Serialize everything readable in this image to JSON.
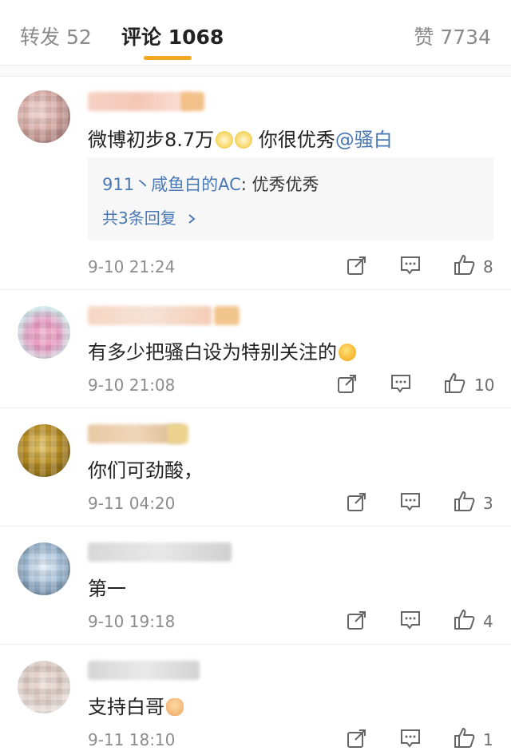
{
  "tabs": {
    "repost": "转发 52",
    "comments": "评论 1068",
    "likes": "赞 7734"
  },
  "comments": [
    {
      "text": "微博初步8.7万",
      "text_suffix": " 你很优秀",
      "mention": "@骚白",
      "reply_user": "911丶咸鱼白的AC",
      "reply_sep": ": ",
      "reply_text": "优秀优秀",
      "reply_more": "共3条回复",
      "time": "9-10 21:24",
      "likes": "8"
    },
    {
      "text": "有多少把骚白设为特别关注的",
      "time": "9-10 21:08",
      "likes": "10"
    },
    {
      "text": "你们可劲酸，",
      "time": "9-11 04:20",
      "likes": "3"
    },
    {
      "text": "第一",
      "time": "9-10 19:18",
      "likes": "4"
    },
    {
      "text": "支持白哥",
      "time": "9-11 18:10",
      "likes": "1"
    }
  ],
  "colors": {
    "accent_underline": "#f5a623",
    "link_blue": "#4a78b4",
    "meta_gray": "#8c8c8c"
  },
  "icons": [
    "share-icon",
    "comment-icon",
    "thumbs-up-icon",
    "chevron-right-icon"
  ]
}
